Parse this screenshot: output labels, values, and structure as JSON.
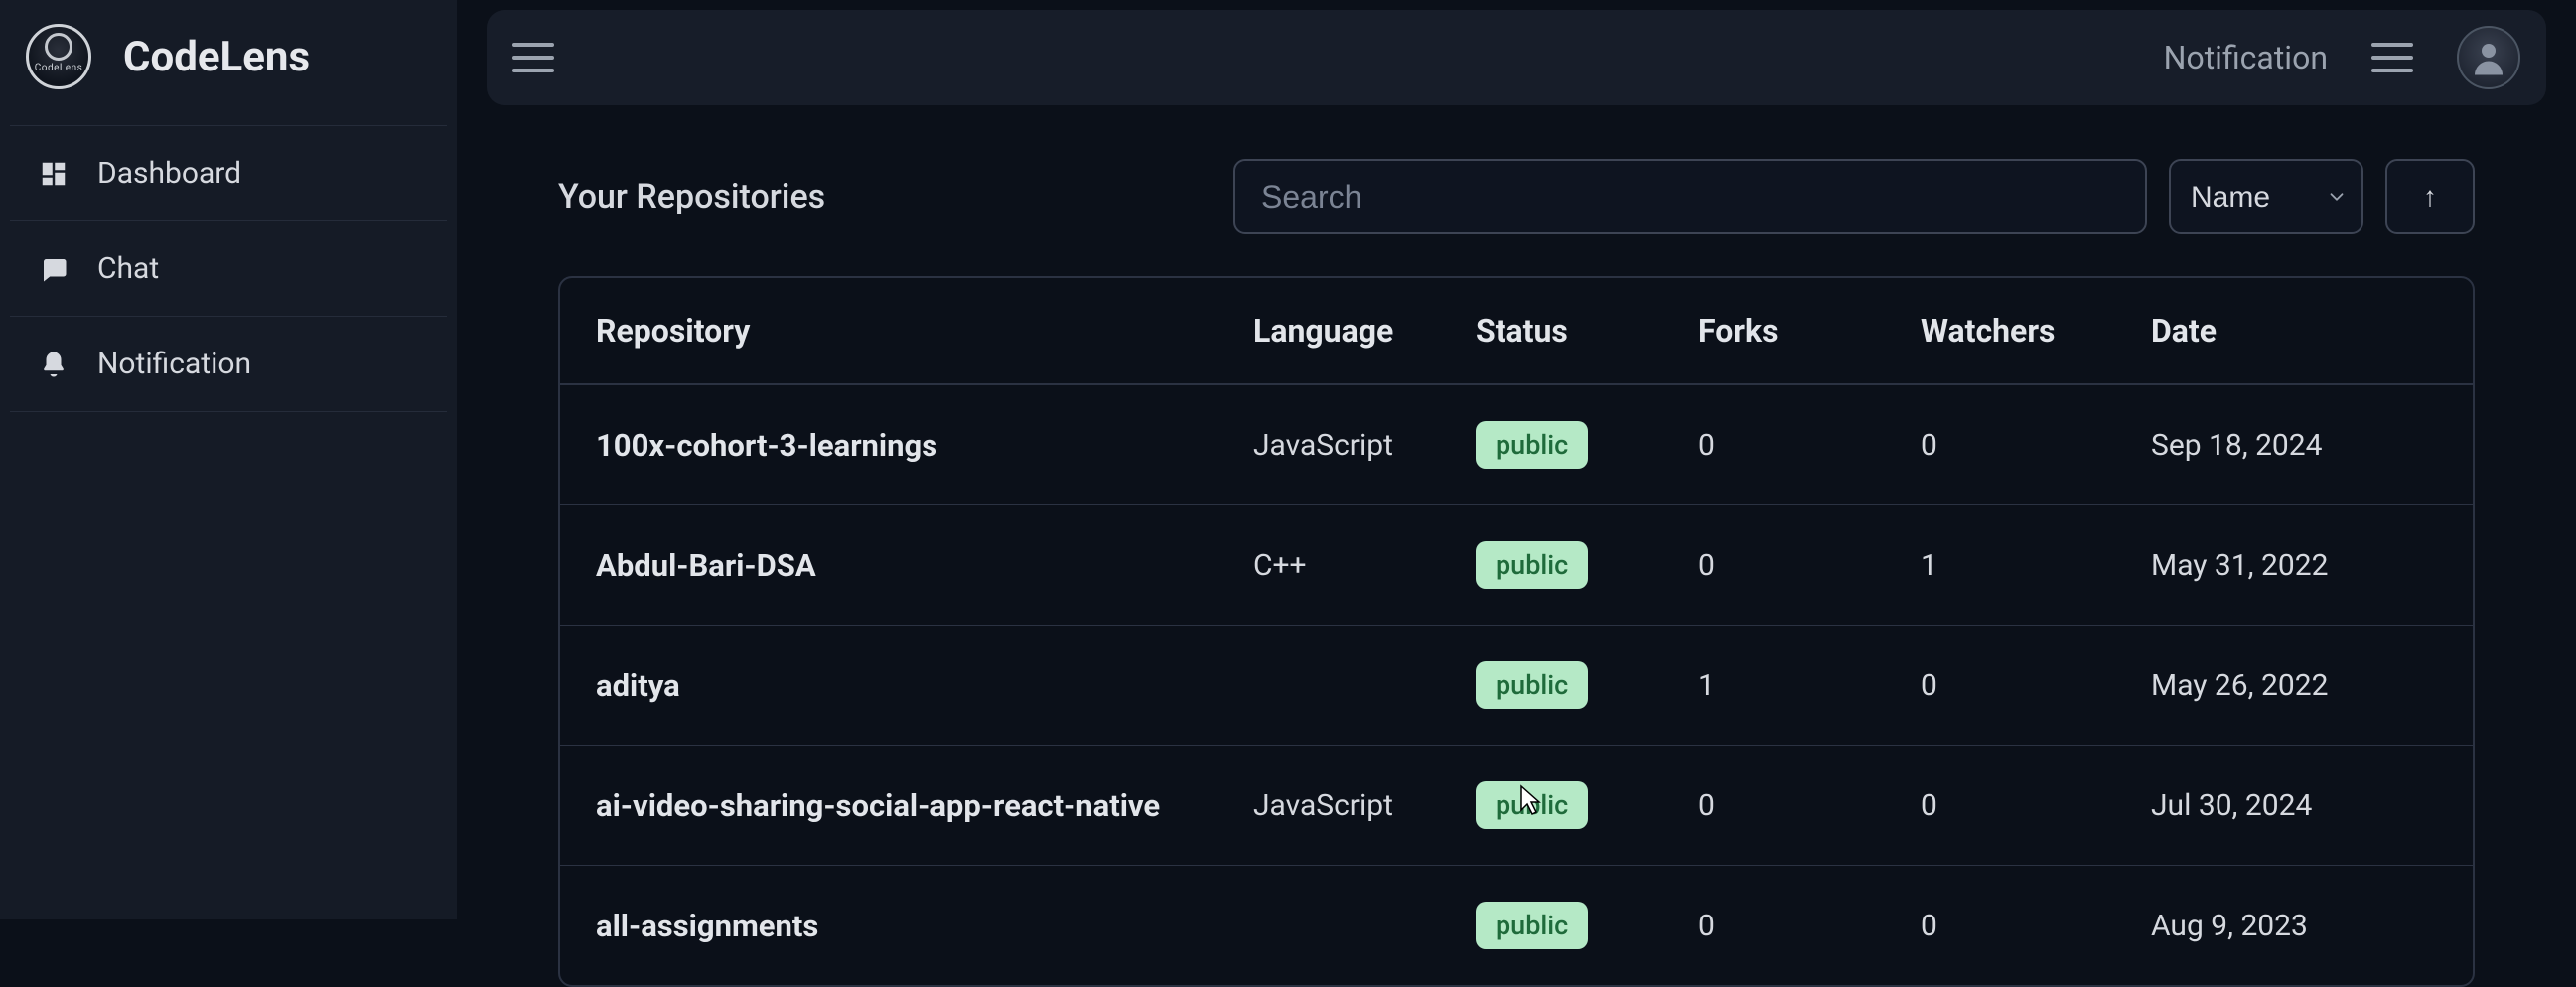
{
  "brand": {
    "name": "CodeLens",
    "logo_sub": "CodeLens"
  },
  "sidebar": {
    "items": [
      {
        "label": "Dashboard",
        "icon": "dashboard-icon"
      },
      {
        "label": "Chat",
        "icon": "chat-icon"
      },
      {
        "label": "Notification",
        "icon": "bell-icon"
      }
    ]
  },
  "topbar": {
    "notification_label": "Notification"
  },
  "page": {
    "title": "Your Repositories",
    "search_placeholder": "Search",
    "sort_selected": "Name",
    "sort_direction_glyph": "↑"
  },
  "table": {
    "columns": {
      "repository": "Repository",
      "language": "Language",
      "status": "Status",
      "forks": "Forks",
      "watchers": "Watchers",
      "date": "Date"
    },
    "rows": [
      {
        "repo": "100x-cohort-3-learnings",
        "language": "JavaScript",
        "status": "public",
        "forks": "0",
        "watchers": "0",
        "date": "Sep 18, 2024"
      },
      {
        "repo": "Abdul-Bari-DSA",
        "language": "C++",
        "status": "public",
        "forks": "0",
        "watchers": "1",
        "date": "May 31, 2022"
      },
      {
        "repo": "aditya",
        "language": "",
        "status": "public",
        "forks": "1",
        "watchers": "0",
        "date": "May 26, 2022"
      },
      {
        "repo": "ai-video-sharing-social-app-react-native",
        "language": "JavaScript",
        "status": "public",
        "forks": "0",
        "watchers": "0",
        "date": "Jul 30, 2024"
      },
      {
        "repo": "all-assignments",
        "language": "",
        "status": "public",
        "forks": "0",
        "watchers": "0",
        "date": "Aug 9, 2023"
      }
    ]
  },
  "colors": {
    "bg": "#0b1019",
    "panel": "#151b26",
    "border": "#2b3242",
    "badge_bg": "#b5e9c6",
    "badge_fg": "#1f6b3b"
  }
}
